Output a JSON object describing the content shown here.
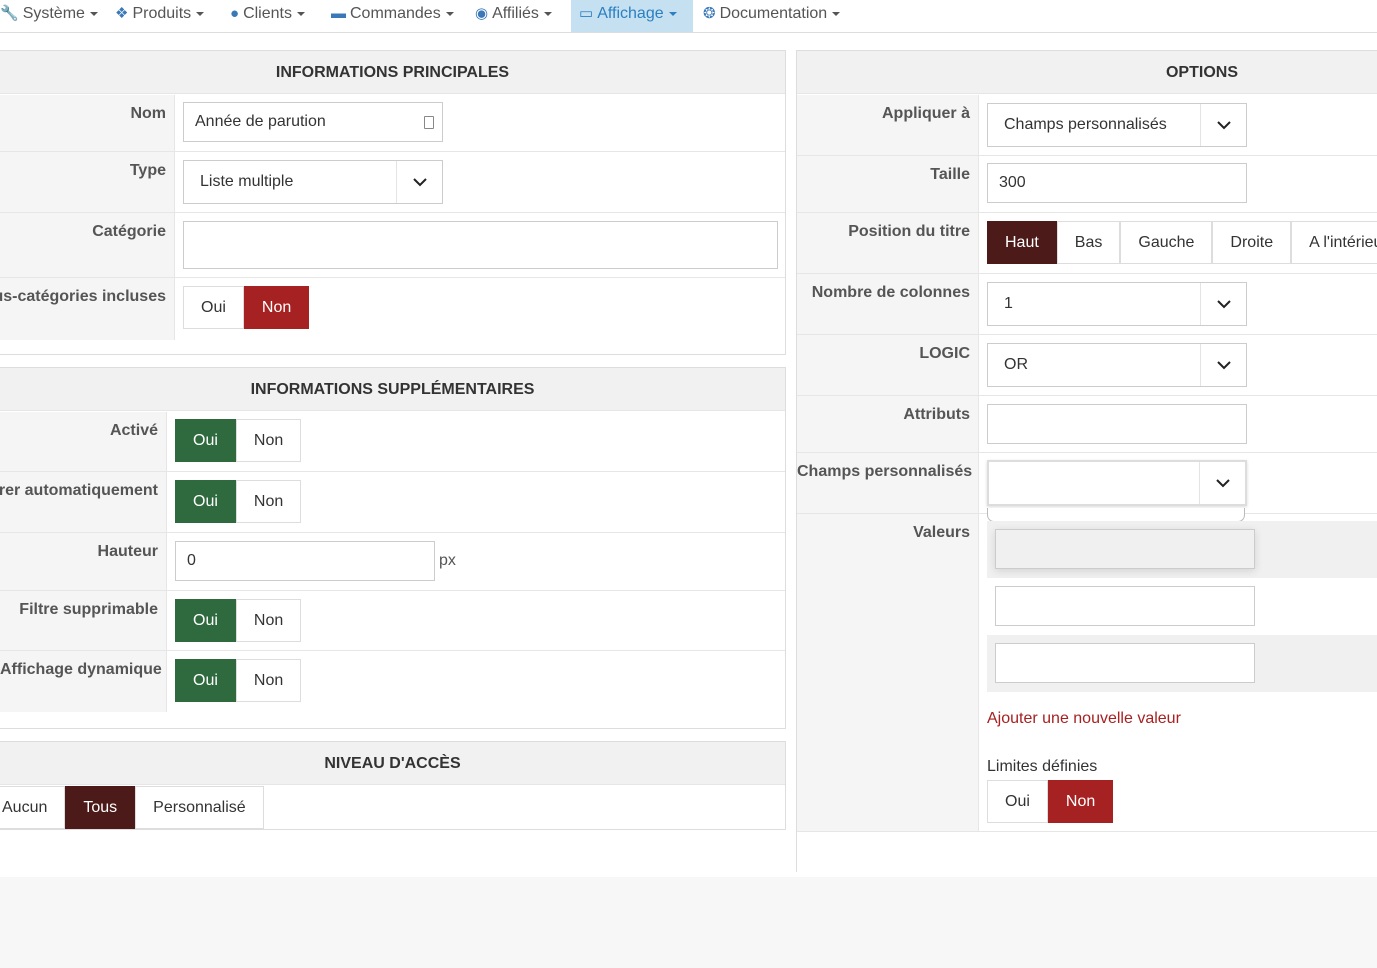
{
  "nav": [
    {
      "label": "Système",
      "icon": "wrench-icon"
    },
    {
      "label": "Produits",
      "icon": "cubes-icon"
    },
    {
      "label": "Clients",
      "icon": "user-icon"
    },
    {
      "label": "Commandes",
      "icon": "credit-card-icon"
    },
    {
      "label": "Affiliés",
      "icon": "users-icon"
    },
    {
      "label": "Affichage",
      "icon": "desktop-icon",
      "active": true
    },
    {
      "label": "Documentation",
      "icon": "life-ring-icon"
    }
  ],
  "main_info": {
    "title": "INFORMATIONS PRINCIPALES",
    "nom_label": "Nom",
    "nom_value": "Année de parution",
    "type_label": "Type",
    "type_value": "Liste multiple",
    "categorie_label": "Catégorie",
    "categorie_value": "",
    "souscat_label": "Sous-catégories incluses",
    "souscat_oui": "Oui",
    "souscat_non": "Non"
  },
  "extra_info": {
    "title": "INFORMATIONS SUPPLÉMENTAIRES",
    "active_label": "Activé",
    "filtrer_label": "Filtrer automatiquement",
    "hauteur_label": "Hauteur",
    "hauteur_value": "0",
    "hauteur_unit": "px",
    "filtre_label": "Filtre supprimable",
    "dyn_label": "Affichage dynamique",
    "oui": "Oui",
    "non": "Non"
  },
  "access": {
    "title": "NIVEAU D'ACCÈS",
    "aucun": "Aucun",
    "tous": "Tous",
    "perso": "Personnalisé"
  },
  "options": {
    "title": "OPTIONS",
    "appliquer_label": "Appliquer à",
    "appliquer_value": "Champs personnalisés",
    "taille_label": "Taille",
    "taille_value": "300",
    "position_label": "Position du titre",
    "positions": [
      "Haut",
      "Bas",
      "Gauche",
      "Droite",
      "A l'intérieur"
    ],
    "colonnes_label": "Nombre de colonnes",
    "colonnes_value": "1",
    "logic_label": "LOGIC",
    "logic_value": "OR",
    "attributs_label": "Attributs",
    "attributs_value": "",
    "champs_label": "Champs personnalisés",
    "champs_value": "",
    "valeurs_label": "Valeurs",
    "add_value": "Ajouter une nouvelle valeur",
    "limites_label": "Limites définies",
    "limites_oui": "Oui",
    "limites_non": "Non"
  }
}
